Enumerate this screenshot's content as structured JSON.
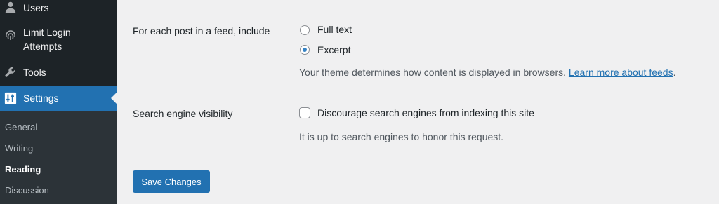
{
  "sidebar": {
    "menu": [
      {
        "label": "Users",
        "icon": "users-icon"
      },
      {
        "label": "Limit Login Attempts",
        "icon": "fingerprint-icon"
      },
      {
        "label": "Tools",
        "icon": "wrench-icon"
      },
      {
        "label": "Settings",
        "icon": "settings-sliders-icon"
      }
    ],
    "submenu": [
      {
        "label": "General"
      },
      {
        "label": "Writing"
      },
      {
        "label": "Reading",
        "current": true
      },
      {
        "label": "Discussion"
      }
    ]
  },
  "feed": {
    "label": "For each post in a feed, include",
    "options": [
      {
        "label": "Full text",
        "checked": false
      },
      {
        "label": "Excerpt",
        "checked": true
      }
    ],
    "description": "Your theme determines how content is displayed in browsers.",
    "link_text": "Learn more about feeds",
    "description_end": "."
  },
  "visibility": {
    "label": "Search engine visibility",
    "checkbox_label": "Discourage search engines from indexing this site",
    "checked": false,
    "description": "It is up to search engines to honor this request."
  },
  "save_button": "Save Changes",
  "colors": {
    "accent": "#2271b1",
    "sidebar_bg": "#1d2327",
    "submenu_bg": "#2c3338",
    "page_bg": "#f0f0f1"
  }
}
